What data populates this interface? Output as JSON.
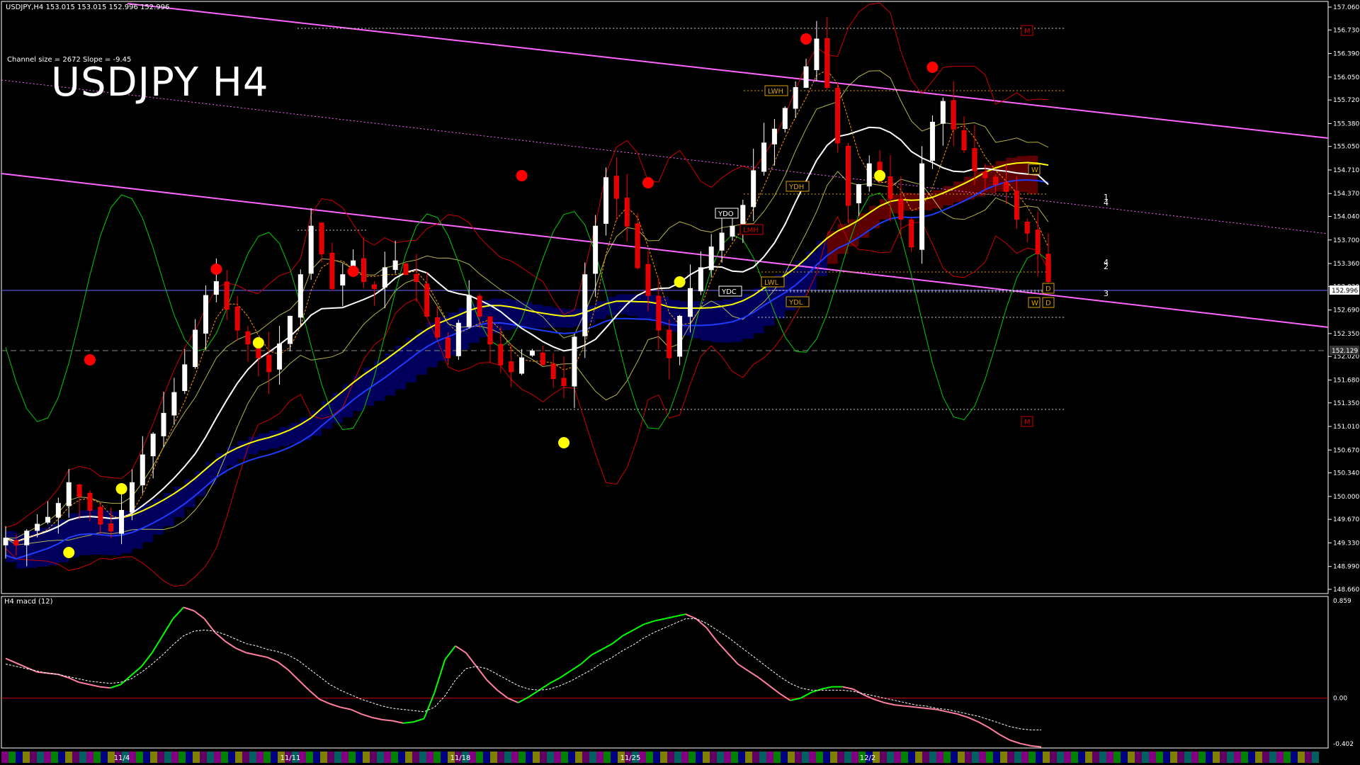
{
  "header": {
    "symbol_info": "USDJPY,H4  153.015 153.015 152.996 152.996",
    "channel_info": "Channel size = 2672 Slope = -9.45",
    "big_title": "USDJPY H4",
    "macd_label": "H4  macd (12)"
  },
  "colors": {
    "background": "#000000",
    "bull_candle": "#ffffff",
    "bear_candle": "#ff0000",
    "ma_white": "#ffffff",
    "ma_yellow": "#ffff00",
    "ma_blue": "#1e3cff",
    "bollinger": "#cc0000",
    "channel": "#ff66ff",
    "stoch_green": "#00cc00",
    "macd_up": "#00ff00",
    "macd_down": "#ff7f9f",
    "signal": "#ffffff",
    "cloud_blue": "#0000cc",
    "cloud_red": "#cc0000",
    "zero_line": "#cc0000"
  },
  "chart_data": [
    {
      "type": "candlestick",
      "title": "USDJPY H4",
      "ylim": [
        148.66,
        157.06
      ],
      "y_ticks": [
        "157.060",
        "156.730",
        "156.390",
        "156.050",
        "155.720",
        "155.380",
        "155.050",
        "154.710",
        "154.370",
        "154.040",
        "153.700",
        "153.360",
        "153.030",
        "152.690",
        "152.350",
        "152.020",
        "151.680",
        "151.350",
        "151.010",
        "150.670",
        "150.340",
        "150.000",
        "149.670",
        "149.330",
        "148.990",
        "148.660"
      ],
      "x_ticks": [
        "11/4",
        "11/11",
        "11/18",
        "11/25",
        "12/2"
      ],
      "current_price": "152.996",
      "ref_price": "152.129",
      "closes": [
        149.4,
        149.3,
        149.5,
        149.6,
        149.7,
        149.9,
        150.2,
        150.0,
        149.8,
        149.6,
        149.5,
        149.8,
        150.2,
        150.6,
        150.9,
        151.2,
        151.5,
        151.9,
        152.4,
        152.9,
        153.1,
        152.7,
        152.4,
        152.2,
        152.0,
        151.8,
        152.2,
        152.6,
        153.2,
        153.9,
        153.5,
        153.0,
        153.2,
        153.4,
        153.1,
        153.0,
        153.3,
        153.4,
        153.2,
        153.1,
        152.6,
        152.3,
        152.0,
        152.5,
        152.9,
        152.6,
        152.2,
        151.9,
        151.8,
        152.0,
        152.1,
        151.9,
        151.7,
        151.6,
        152.3,
        153.2,
        153.9,
        154.6,
        154.3,
        153.9,
        153.3,
        152.9,
        152.4,
        152.0,
        152.6,
        153.0,
        153.3,
        153.6,
        153.8,
        153.9,
        154.2,
        154.7,
        155.1,
        155.3,
        155.6,
        155.9,
        156.2,
        156.6,
        155.9,
        155.1,
        154.2,
        154.5,
        154.8,
        154.6,
        154.3,
        154.0,
        153.6,
        154.8,
        155.4,
        155.7,
        155.3,
        155.0,
        154.7,
        154.6,
        154.5,
        154.4,
        154.0,
        153.8,
        153.5,
        153.1
      ]
    },
    {
      "type": "line",
      "title": "H4 macd (12)",
      "ylim": [
        -0.402,
        0.859
      ],
      "y_ticks": [
        "0.859",
        "0.00",
        "-0.402"
      ],
      "macd": [
        0.35,
        0.31,
        0.27,
        0.23,
        0.22,
        0.21,
        0.18,
        0.14,
        0.12,
        0.1,
        0.09,
        0.12,
        0.2,
        0.28,
        0.4,
        0.55,
        0.7,
        0.8,
        0.77,
        0.7,
        0.58,
        0.5,
        0.44,
        0.4,
        0.38,
        0.36,
        0.32,
        0.25,
        0.16,
        0.07,
        -0.01,
        -0.05,
        -0.08,
        -0.1,
        -0.14,
        -0.17,
        -0.19,
        -0.2,
        -0.22,
        -0.21,
        -0.18,
        0.05,
        0.34,
        0.46,
        0.4,
        0.28,
        0.16,
        0.07,
        0.0,
        -0.04,
        0.01,
        0.07,
        0.13,
        0.18,
        0.24,
        0.3,
        0.38,
        0.43,
        0.48,
        0.55,
        0.6,
        0.65,
        0.68,
        0.7,
        0.72,
        0.74,
        0.7,
        0.62,
        0.5,
        0.4,
        0.3,
        0.24,
        0.18,
        0.11,
        0.04,
        -0.02,
        0.0,
        0.05,
        0.08,
        0.1,
        0.1,
        0.08,
        0.03,
        -0.01,
        -0.04,
        -0.06,
        -0.07,
        -0.08,
        -0.09,
        -0.1,
        -0.12,
        -0.14,
        -0.17,
        -0.21,
        -0.26,
        -0.32,
        -0.37,
        -0.4,
        -0.42,
        -0.43
      ],
      "signal": [
        0.3,
        0.28,
        0.26,
        0.24,
        0.22,
        0.21,
        0.19,
        0.17,
        0.15,
        0.14,
        0.13,
        0.14,
        0.17,
        0.23,
        0.3,
        0.38,
        0.47,
        0.55,
        0.59,
        0.6,
        0.59,
        0.56,
        0.52,
        0.48,
        0.46,
        0.43,
        0.41,
        0.38,
        0.33,
        0.26,
        0.19,
        0.12,
        0.07,
        0.03,
        -0.01,
        -0.04,
        -0.07,
        -0.09,
        -0.1,
        -0.11,
        -0.12,
        -0.08,
        0.02,
        0.16,
        0.26,
        0.28,
        0.26,
        0.21,
        0.16,
        0.11,
        0.08,
        0.07,
        0.08,
        0.11,
        0.15,
        0.2,
        0.25,
        0.31,
        0.36,
        0.42,
        0.47,
        0.53,
        0.58,
        0.62,
        0.66,
        0.7,
        0.7,
        0.66,
        0.6,
        0.54,
        0.47,
        0.4,
        0.33,
        0.26,
        0.19,
        0.13,
        0.09,
        0.07,
        0.07,
        0.07,
        0.07,
        0.06,
        0.04,
        0.02,
        0.0,
        -0.02,
        -0.04,
        -0.06,
        -0.07,
        -0.09,
        -0.1,
        -0.12,
        -0.14,
        -0.16,
        -0.19,
        -0.22,
        -0.25,
        -0.27,
        -0.28,
        -0.28
      ]
    }
  ],
  "annotations": {
    "levels": [
      "LWH",
      "YDH",
      "YDO",
      "LMH",
      "YDC",
      "LWL",
      "YDL",
      "W",
      "D",
      "M"
    ],
    "channel_markers": [
      "1",
      "4",
      "4",
      "2",
      "3"
    ]
  }
}
